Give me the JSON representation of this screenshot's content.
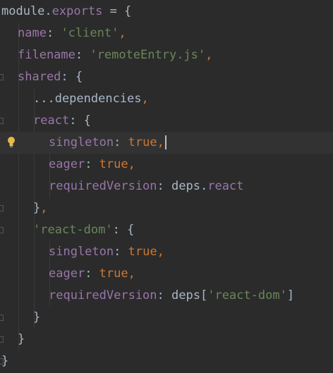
{
  "editor": {
    "lines": [
      {
        "tokens": [
          {
            "t": "module",
            "c": "plain"
          },
          {
            "t": ".",
            "c": "plain"
          },
          {
            "t": "exports",
            "c": "prop"
          },
          {
            "t": " = {",
            "c": "plain"
          }
        ]
      },
      {
        "tokens": [
          {
            "t": "name",
            "c": "prop"
          },
          {
            "t": ": ",
            "c": "plain"
          },
          {
            "t": "'client'",
            "c": "str"
          },
          {
            "t": ",",
            "c": "kw"
          }
        ]
      },
      {
        "tokens": [
          {
            "t": "filename",
            "c": "prop"
          },
          {
            "t": ": ",
            "c": "plain"
          },
          {
            "t": "'remoteEntry.js'",
            "c": "str"
          },
          {
            "t": ",",
            "c": "kw"
          }
        ]
      },
      {
        "tokens": [
          {
            "t": "shared",
            "c": "prop"
          },
          {
            "t": ": {",
            "c": "plain"
          }
        ]
      },
      {
        "tokens": [
          {
            "t": "...dependencies",
            "c": "plain"
          },
          {
            "t": ",",
            "c": "kw"
          }
        ]
      },
      {
        "tokens": [
          {
            "t": "react",
            "c": "prop"
          },
          {
            "t": ": {",
            "c": "plain"
          }
        ]
      },
      {
        "tokens": [
          {
            "t": "singleton",
            "c": "prop"
          },
          {
            "t": ": ",
            "c": "plain"
          },
          {
            "t": "true",
            "c": "kw"
          },
          {
            "t": ",",
            "c": "kw"
          }
        ]
      },
      {
        "tokens": [
          {
            "t": "eager",
            "c": "prop"
          },
          {
            "t": ": ",
            "c": "plain"
          },
          {
            "t": "true",
            "c": "kw"
          },
          {
            "t": ",",
            "c": "kw"
          }
        ]
      },
      {
        "tokens": [
          {
            "t": "requiredVersion",
            "c": "prop"
          },
          {
            "t": ": ",
            "c": "plain"
          },
          {
            "t": "deps",
            "c": "plain"
          },
          {
            "t": ".",
            "c": "plain"
          },
          {
            "t": "react",
            "c": "prop"
          }
        ]
      },
      {
        "tokens": [
          {
            "t": "}",
            "c": "plain"
          },
          {
            "t": ",",
            "c": "kw"
          }
        ]
      },
      {
        "tokens": [
          {
            "t": "'react-dom'",
            "c": "str"
          },
          {
            "t": ": {",
            "c": "plain"
          }
        ]
      },
      {
        "tokens": [
          {
            "t": "singleton",
            "c": "prop"
          },
          {
            "t": ": ",
            "c": "plain"
          },
          {
            "t": "true",
            "c": "kw"
          },
          {
            "t": ",",
            "c": "kw"
          }
        ]
      },
      {
        "tokens": [
          {
            "t": "eager",
            "c": "prop"
          },
          {
            "t": ": ",
            "c": "plain"
          },
          {
            "t": "true",
            "c": "kw"
          },
          {
            "t": ",",
            "c": "kw"
          }
        ]
      },
      {
        "tokens": [
          {
            "t": "requiredVersion",
            "c": "prop"
          },
          {
            "t": ": ",
            "c": "plain"
          },
          {
            "t": "deps",
            "c": "plain"
          },
          {
            "t": "[",
            "c": "plain"
          },
          {
            "t": "'react-dom'",
            "c": "str"
          },
          {
            "t": "]",
            "c": "plain"
          }
        ]
      },
      {
        "tokens": [
          {
            "t": "}",
            "c": "plain"
          }
        ]
      },
      {
        "tokens": [
          {
            "t": "}",
            "c": "plain"
          }
        ]
      },
      {
        "tokens": [
          {
            "t": "}",
            "c": "plain"
          }
        ]
      }
    ],
    "caret_line": 6,
    "intention_bulb_line": 6,
    "colors": {
      "background": "#2b2b2b",
      "active_line": "#323232",
      "keyword": "#cc7832",
      "string": "#6a8759",
      "property": "#9876aa",
      "plain": "#a9b7c6",
      "bulb": "#e8b84a"
    },
    "icons": {
      "intention": "lightbulb-icon",
      "fold": "fold-marker-icon"
    }
  }
}
